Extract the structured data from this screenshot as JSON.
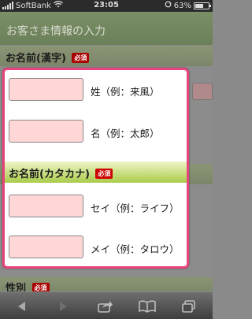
{
  "status_bar": {
    "carrier": "SoftBank",
    "time": "23:05",
    "battery": "63%",
    "battery_level": 0.63
  },
  "page": {
    "header_title": "お客さま情報の入力",
    "section_kanji": "お名前(漢字)",
    "section_gender": "性別",
    "required_badge": "必須"
  },
  "form": {
    "last_name_label": "姓（例：来風）",
    "first_name_label": "名（例：太郎）",
    "kana_section_title": "お名前(カタカナ)",
    "required_badge": "必須",
    "last_name_kana_label": "セイ（例：ライフ）",
    "first_name_kana_label": "メイ（例：タロウ）"
  },
  "toolbar": {
    "icons": [
      "back-icon",
      "forward-icon",
      "share-icon",
      "bookmarks-icon",
      "tabs-icon"
    ]
  },
  "colors": {
    "popup_border": "#e8437a",
    "input_fill": "#ffd7d7",
    "required_badge": "#cc0000",
    "kana_bar": "#a9cc4a"
  }
}
